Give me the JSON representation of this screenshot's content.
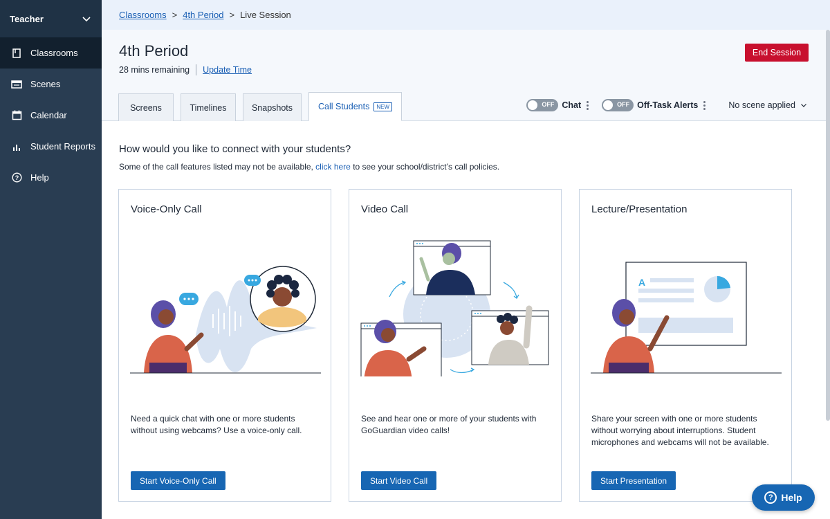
{
  "sidebar": {
    "user_menu": "Teacher",
    "items": [
      {
        "label": "Classrooms",
        "icon": "book-icon",
        "active": true
      },
      {
        "label": "Scenes",
        "icon": "scenes-icon",
        "active": false
      },
      {
        "label": "Calendar",
        "icon": "calendar-icon",
        "active": false
      },
      {
        "label": "Student Reports",
        "icon": "bar-chart-icon",
        "active": false
      },
      {
        "label": "Help",
        "icon": "help-circle-icon",
        "active": false
      }
    ]
  },
  "breadcrumb": {
    "items": [
      "Classrooms",
      "4th Period"
    ],
    "current": "Live Session",
    "separator": ">"
  },
  "header": {
    "title": "4th Period",
    "time_remaining": "28 mins remaining",
    "update_time": "Update Time",
    "end_session": "End Session"
  },
  "tabs": [
    {
      "label": "Screens"
    },
    {
      "label": "Timelines"
    },
    {
      "label": "Snapshots"
    },
    {
      "label": "Call Students",
      "badge": "NEW",
      "active": true
    }
  ],
  "controls": {
    "chat_toggle_state": "OFF",
    "chat_label": "Chat",
    "offtask_toggle_state": "OFF",
    "offtask_label": "Off-Task Alerts",
    "scene_select": "No scene applied"
  },
  "content": {
    "question": "How would you like to connect with your students?",
    "note_before": "Some of the call features listed may not be available,",
    "note_link": "click here",
    "note_after": "to see your school/district’s call policies."
  },
  "cards": [
    {
      "title": "Voice-Only Call",
      "description": "Need a quick chat with one or more students without using webcams? Use a voice-only call.",
      "button": "Start Voice-Only Call"
    },
    {
      "title": "Video Call",
      "description": "See and hear one or more of your students with GoGuardian video calls!",
      "button": "Start Video Call"
    },
    {
      "title": "Lecture/Presentation",
      "description": "Share your screen with one or more students without worrying about interruptions. Student microphones and webcams will not be available.",
      "button": "Start Presentation"
    }
  ],
  "help_fab": "Help",
  "colors": {
    "sidebar_bg": "#293d52",
    "primary": "#1766b3",
    "danger": "#c8102e",
    "link": "#1a5fb4"
  }
}
